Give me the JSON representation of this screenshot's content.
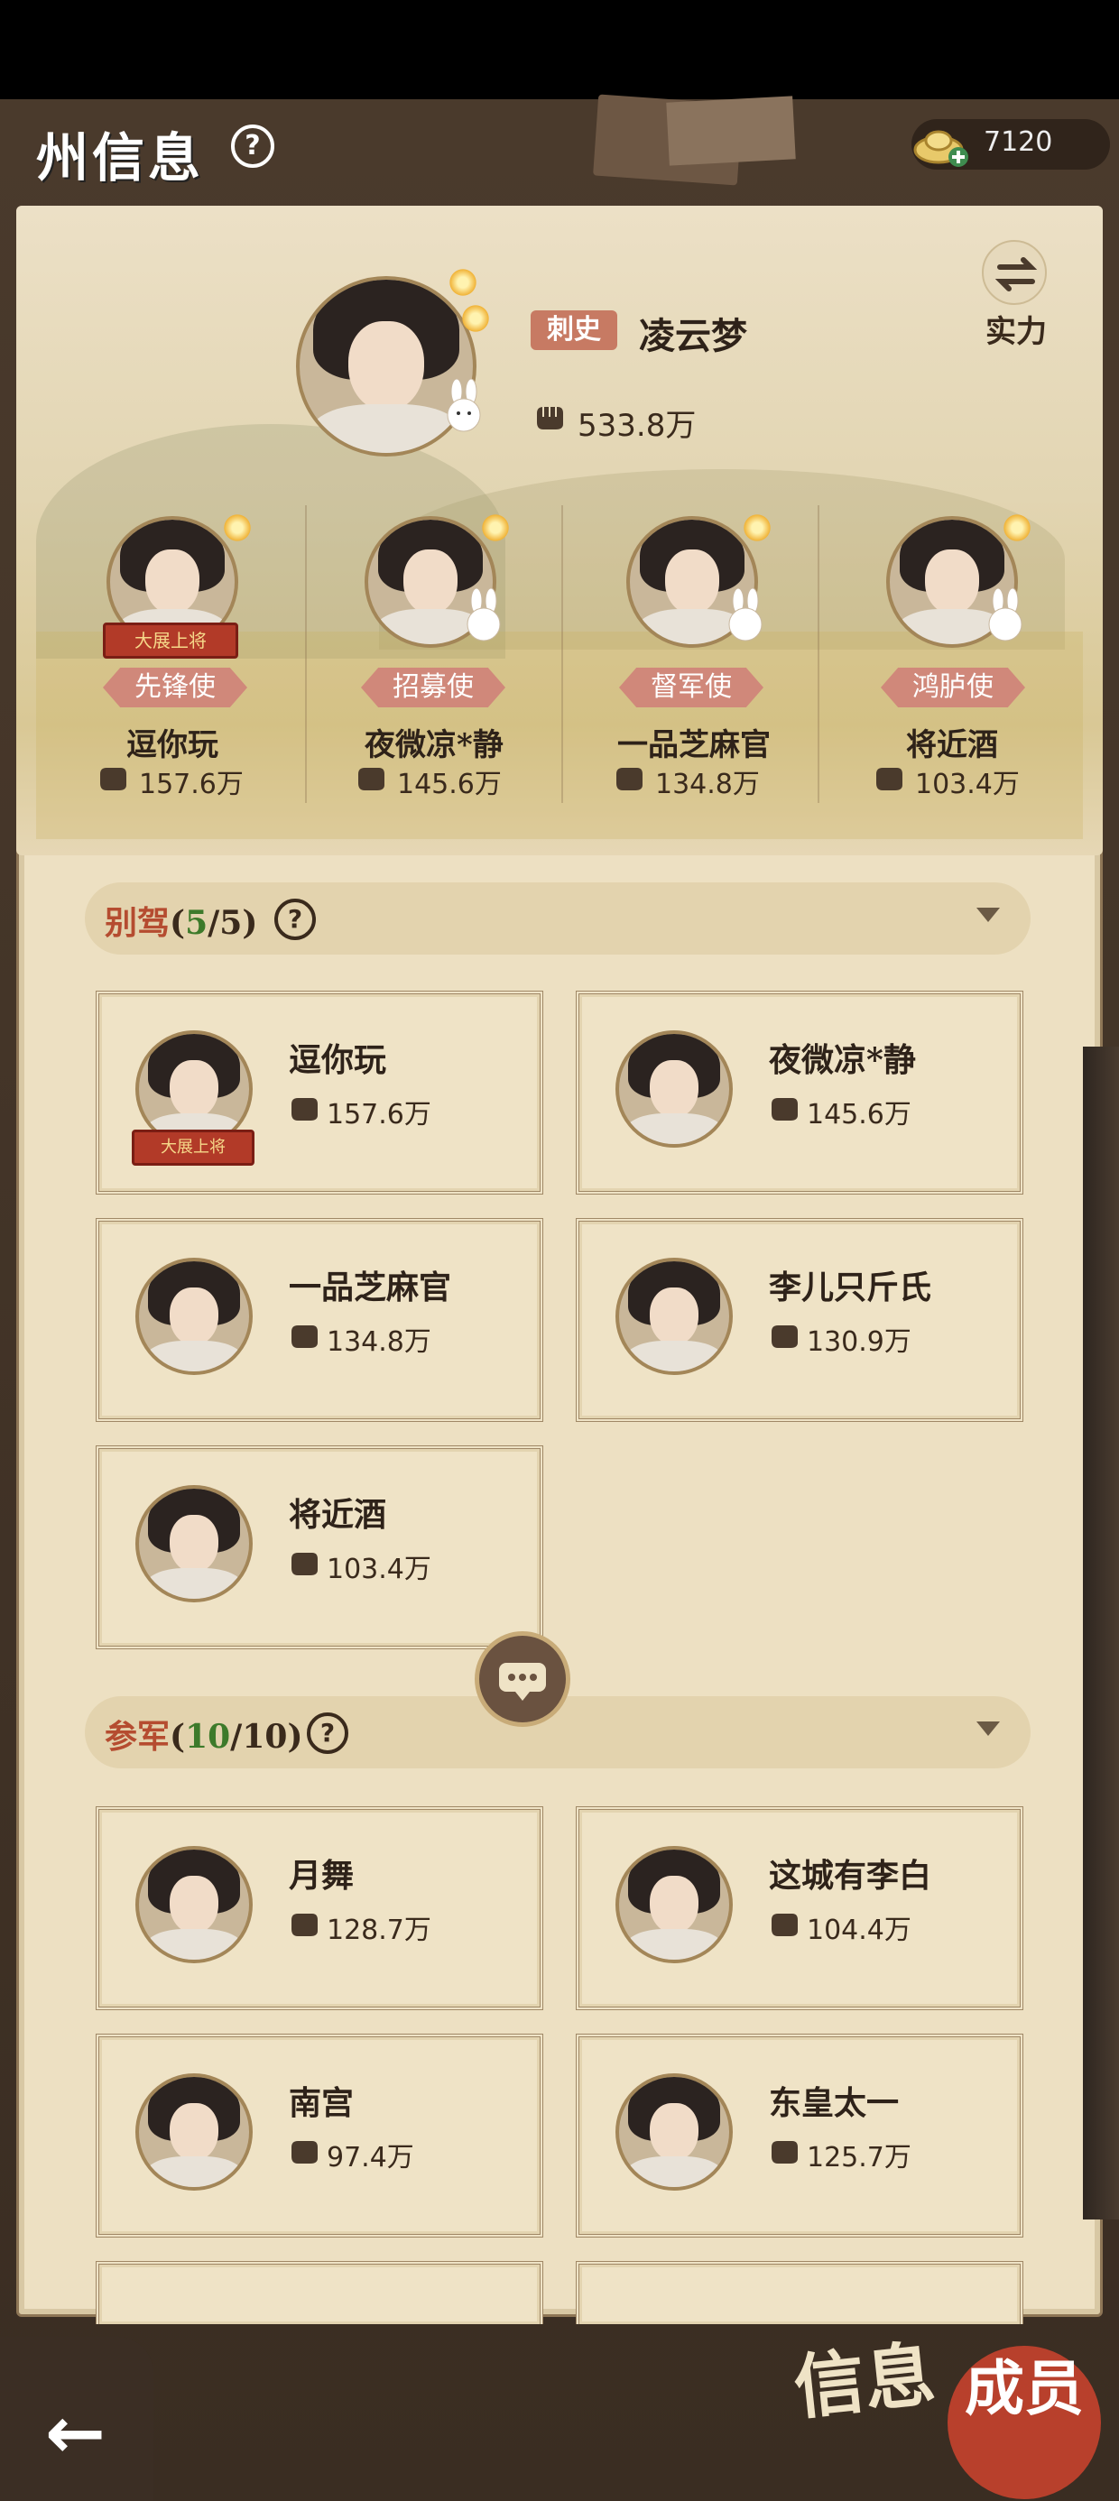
{
  "header": {
    "title": "州信息",
    "help": "?",
    "currency": {
      "icon": "gold-ingot-icon",
      "value": "7120"
    }
  },
  "toggle": {
    "icon": "swap-arrows-icon",
    "label": "实力"
  },
  "leader": {
    "role": "刺史",
    "name": "凌云梦",
    "power": "533.8万"
  },
  "deputies": [
    {
      "role": "先锋使",
      "name": "逗你玩",
      "power": "157.6万",
      "banner": "大展上将"
    },
    {
      "role": "招募使",
      "name": "夜微凉*静",
      "power": "145.6万"
    },
    {
      "role": "督军使",
      "name": "一品芝麻官",
      "power": "134.8万"
    },
    {
      "role": "鸿胪使",
      "name": "将近酒",
      "power": "103.4万"
    }
  ],
  "sections": [
    {
      "title": "别驾",
      "count": "5",
      "total": "5",
      "members": [
        {
          "name": "逗你玩",
          "power": "157.6万",
          "banner": "大展上将"
        },
        {
          "name": "夜微凉*静",
          "power": "145.6万"
        },
        {
          "name": "一品芝麻官",
          "power": "134.8万"
        },
        {
          "name": "李儿只斤氏",
          "power": "130.9万"
        },
        {
          "name": "将近酒",
          "power": "103.4万"
        }
      ]
    },
    {
      "title": "参军",
      "count": "10",
      "total": "10",
      "members": [
        {
          "name": "月舞",
          "power": "128.7万"
        },
        {
          "name": "这城有李白",
          "power": "104.4万"
        },
        {
          "name": "南宫",
          "power": "97.4万"
        },
        {
          "name": "东皇太一",
          "power": "125.7万"
        }
      ]
    }
  ],
  "footer": {
    "back": "←",
    "tab_info": "信息",
    "tab_member": "成员"
  },
  "colors": {
    "accent": "#b54c30",
    "count_green": "#3d7a2a",
    "paper": "#ede0c2"
  }
}
